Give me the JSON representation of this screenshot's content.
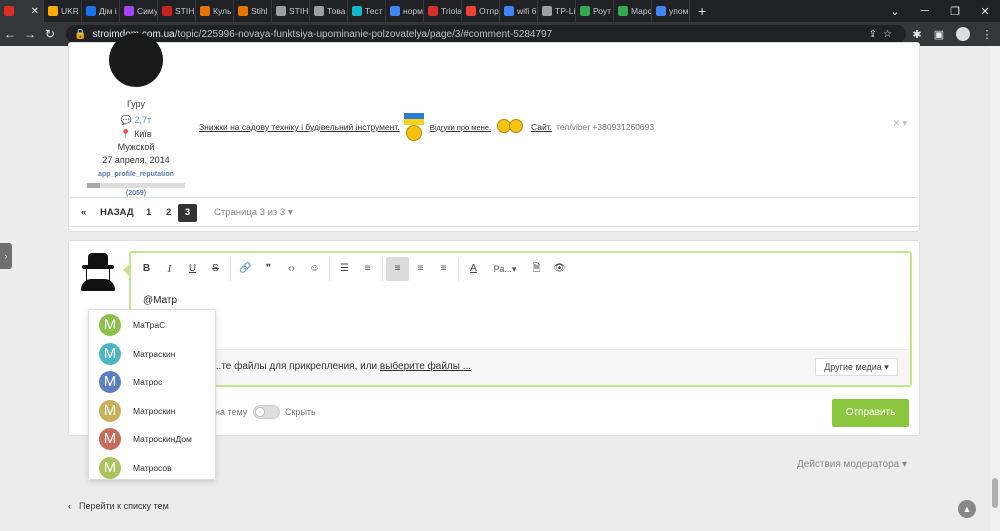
{
  "browser": {
    "tabs": [
      {
        "label": "",
        "color": "#d93025",
        "active": true
      },
      {
        "label": "UKR",
        "color": "#f9ab00"
      },
      {
        "label": "Дім і",
        "color": "#1a73e8"
      },
      {
        "label": "Симу",
        "color": "#a142f4"
      },
      {
        "label": "STIH",
        "color": "#c5221f"
      },
      {
        "label": "Куль",
        "color": "#e37400"
      },
      {
        "label": "Stihl",
        "color": "#e37400"
      },
      {
        "label": "STIH",
        "color": "#9aa0a6"
      },
      {
        "label": "Това",
        "color": "#9aa0a6"
      },
      {
        "label": "Тест",
        "color": "#12b5cb"
      },
      {
        "label": "норм",
        "color": "#4285f4"
      },
      {
        "label": "Triola",
        "color": "#d93025"
      },
      {
        "label": "Отпр",
        "color": "#ea4335"
      },
      {
        "label": "wifi 6",
        "color": "#4285f4"
      },
      {
        "label": "TP-Li",
        "color": "#9aa0a6"
      },
      {
        "label": "Роут",
        "color": "#34a853"
      },
      {
        "label": "Марс",
        "color": "#34a853"
      },
      {
        "label": "упом",
        "color": "#4285f4"
      }
    ],
    "url_host": "stroimdom.com.ua",
    "url_path": "/topic/225996-novaya-funktsiya-upominanie-polzovatelya/page/3/#comment-5284797"
  },
  "post": {
    "author_rank": "Гуру",
    "author_posts": "💬 2,7т",
    "author_city": "📍 Київ",
    "author_gender": "Мужской",
    "author_date": "27 апреля, 2014",
    "author_rep_label": "app_profile_reputation",
    "author_rep_count": "(2059)",
    "author_rep_fraction": 0.13,
    "signature": {
      "link1": "Знижки на садову техніку і будівельний інструмент.",
      "link2": "Відгуки про мене.",
      "link3": "Сайт.",
      "phone": "тел/viber +380931260693"
    }
  },
  "pagination": {
    "prev": "«",
    "back": "НАЗАД",
    "pages": [
      "1",
      "2",
      "3"
    ],
    "info": "Страница 3 из 3 ▾"
  },
  "editor": {
    "toolbar": {
      "bold": "B",
      "italic": "I",
      "underline": "U",
      "strike": "S",
      "link": "🔗",
      "quote": "❞",
      "code": "‹›",
      "emoji": "☺",
      "bullets": "☰",
      "numbers": "≡",
      "align_left": "≡",
      "align_center": "≡",
      "align_right": "≡",
      "color": "A",
      "font_size": "Ра...▾",
      "preview_doc": "🗎",
      "preview": "👁"
    },
    "text": "@Матр",
    "attach_text": "...те файлы для прикрепления, или ",
    "attach_link": "выберите файлы ...",
    "other_media": "Другие медиа ▾"
  },
  "options": {
    "follow_label": "на тему",
    "hide_label": "Скрыть",
    "submit_label": "Отправить"
  },
  "footer": {
    "mod_actions": "Действия модератора ▾",
    "back_link": "Перейти к списку тем"
  },
  "mentions": [
    {
      "letter": "M",
      "name": "МаТраС",
      "color": "#8bc34a"
    },
    {
      "letter": "M",
      "name": "Матраскин",
      "color": "#4db6c4"
    },
    {
      "letter": "M",
      "name": "Матрос",
      "color": "#5c7fc4"
    },
    {
      "letter": "M",
      "name": "Матроскин",
      "color": "#c9b05a"
    },
    {
      "letter": "M",
      "name": "МатроскинДом",
      "color": "#c96a5a"
    },
    {
      "letter": "M",
      "name": "Матросов",
      "color": "#a9c45a"
    }
  ]
}
